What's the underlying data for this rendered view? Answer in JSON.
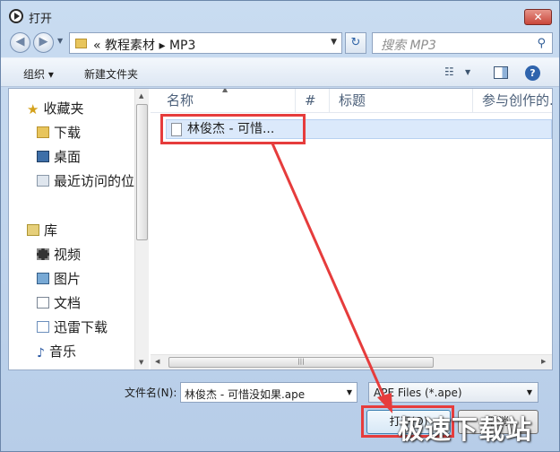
{
  "window": {
    "title": "打开",
    "close_label": "✕"
  },
  "nav": {
    "back_glyph": "◀",
    "forward_glyph": "▶",
    "address_path": "« 教程素材 ▸ MP3",
    "search_placeholder": "搜索 MP3"
  },
  "toolbar": {
    "organize_label": "组织 ▾",
    "new_folder_label": "新建文件夹"
  },
  "sidebar": {
    "items": [
      {
        "label": "收藏夹",
        "icon": "star-icon"
      },
      {
        "label": "下载",
        "icon": "folder-icon"
      },
      {
        "label": "桌面",
        "icon": "desktop-icon"
      },
      {
        "label": "最近访问的位",
        "icon": "recent-places-icon"
      },
      {
        "label": "库",
        "icon": "library-icon"
      },
      {
        "label": "视频",
        "icon": "video-icon"
      },
      {
        "label": "图片",
        "icon": "pictures-icon"
      },
      {
        "label": "文档",
        "icon": "documents-icon"
      },
      {
        "label": "迅雷下载",
        "icon": "thunder-download-icon"
      },
      {
        "label": "音乐",
        "icon": "music-icon"
      }
    ]
  },
  "columns": [
    {
      "label": "名称"
    },
    {
      "label": "#"
    },
    {
      "label": "标题"
    },
    {
      "label": "参与创作的..."
    }
  ],
  "files": [
    {
      "name": "林俊杰 - 可惜...",
      "icon": "file-icon",
      "selected": true
    }
  ],
  "footer": {
    "filename_label": "文件名(N):",
    "filename_value": "林俊杰 - 可惜没如果.ape",
    "filetype_value": "APE Files (*.ape)",
    "open_label": "打开(O)",
    "cancel_label": "取消"
  },
  "watermark": "极速下载站",
  "colors": {
    "highlight": "#e63c3c",
    "selection": "#dbe9fb",
    "frame": "#b7cde8"
  }
}
